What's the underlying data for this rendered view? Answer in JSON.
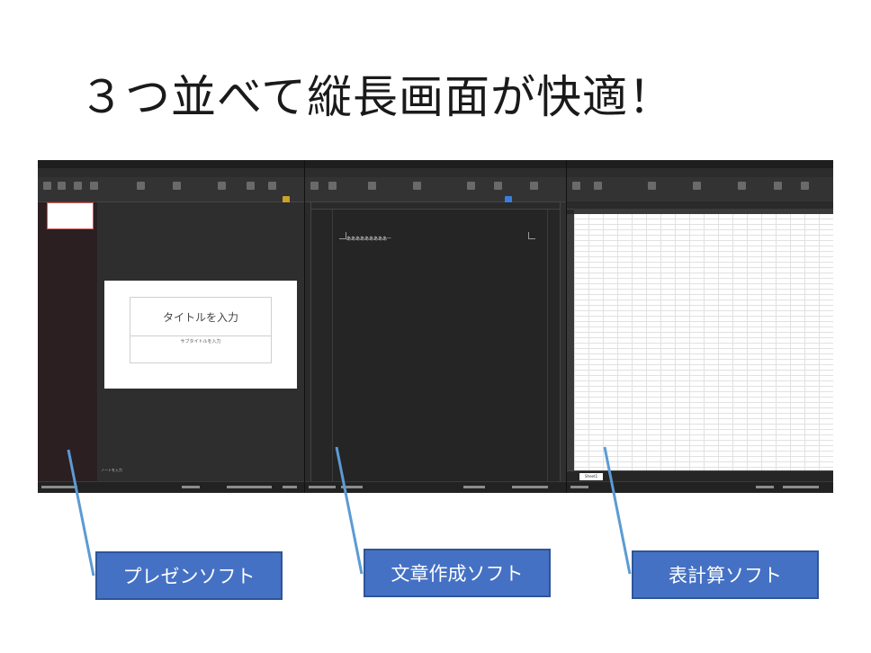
{
  "slide": {
    "title": "３つ並べて縦長画面が快適！"
  },
  "colors": {
    "label_fill": "#4471c4",
    "label_border": "#2f5597",
    "pointer_line": "#5b9bd5",
    "ppt_accent": "#c43e1c",
    "word_accent": "#2b579a",
    "excel_accent": "#217346"
  },
  "windows": {
    "presentation": {
      "slide_title_placeholder": "タイトルを入力",
      "slide_subtitle_placeholder": "サブタイトルを入力",
      "notes_placeholder": "ノートを入力"
    },
    "document": {
      "body_text": "あああああああああー"
    },
    "spreadsheet": {
      "sheet_tab": "Sheet1"
    }
  },
  "labels": {
    "presentation": "プレゼンソフト",
    "document": "文章作成ソフト",
    "spreadsheet": "表計算ソフト"
  }
}
